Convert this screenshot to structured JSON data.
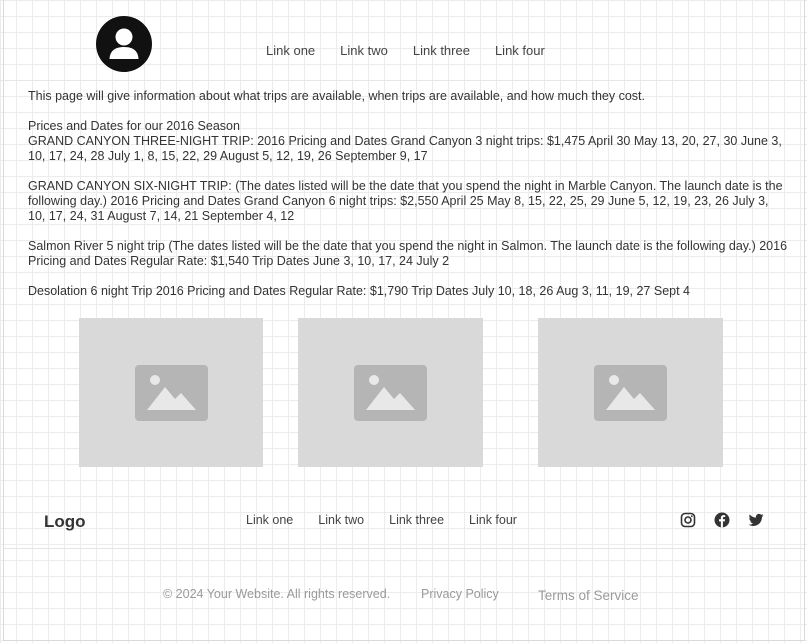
{
  "header": {
    "nav": [
      "Link one",
      "Link two",
      "Link three",
      "Link four"
    ]
  },
  "content": {
    "intro": "This page will give information about what trips are available, when trips are available, and how much they cost.",
    "season_title": "Prices and Dates for our 2016 Season",
    "trip_gc3": "GRAND CANYON THREE-NIGHT TRIP: 2016 Pricing and Dates Grand Canyon 3 night trips: $1,475 April 30 May 13, 20, 27, 30 June 3, 10, 17, 24, 28 July 1, 8, 15, 22, 29 August 5, 12, 19, 26 September 9, 17",
    "trip_gc6": "GRAND CANYON SIX-NIGHT TRIP: (The dates listed will be the date that you spend the night in Marble Canyon. The launch date is the following day.) 2016 Pricing and Dates Grand Canyon 6 night trips: $2,550 April 25 May 8, 15, 22, 25, 29 June 5, 12, 19, 23, 26 July 3, 10, 17, 24, 31 August 7, 14, 21 September 4, 12",
    "trip_salmon": "Salmon River 5 night trip (The dates listed will be the date that you spend the night in Salmon. The launch date is the following day.) 2016 Pricing and Dates Regular Rate: $1,540 Trip Dates June 3, 10, 17, 24 July 2",
    "trip_desolation": "Desolation 6 night Trip 2016 Pricing and Dates Regular Rate: $1,790 Trip Dates July 10, 18, 26 Aug 3, 11, 19, 27 Sept 4"
  },
  "images": [
    "image-placeholder-icon",
    "image-placeholder-icon",
    "image-placeholder-icon"
  ],
  "footer": {
    "logo": "Logo",
    "nav": [
      "Link one",
      "Link two",
      "Link three",
      "Link four"
    ],
    "social": [
      "instagram-icon",
      "facebook-icon",
      "twitter-icon"
    ],
    "copyright": "© 2024 Your Website. All rights reserved.",
    "privacy": "Privacy Policy",
    "terms": "Terms of Service"
  },
  "colors": {
    "placeholder_bg": "#d9d9d9",
    "placeholder_icon": "#b5b5b5",
    "text": "#333333",
    "muted": "#9a9a9a"
  }
}
